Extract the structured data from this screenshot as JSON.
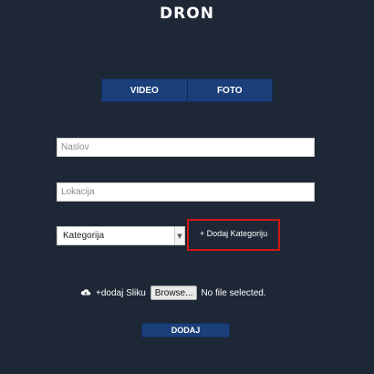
{
  "logo": {
    "text": "DRON"
  },
  "tabs": [
    {
      "label": "VIDEO"
    },
    {
      "label": "FOTO"
    }
  ],
  "form": {
    "naslov_placeholder": "Naslov",
    "lokacija_placeholder": "Lokacija",
    "kategorija_selected": "Kategorija",
    "add_category_label": "+ Dodaj Kategoriju",
    "upload_label": "+dodaj Sliku",
    "browse_label": "Browse...",
    "file_status": "No file selected.",
    "submit_label": "DODAJ"
  },
  "icons": {
    "dropdown": "chevron-down-icon",
    "upload": "cloud-upload-icon"
  },
  "colors": {
    "background": "#1e2735",
    "button_blue": "#1a3f7a",
    "highlight_red": "#d01818"
  }
}
